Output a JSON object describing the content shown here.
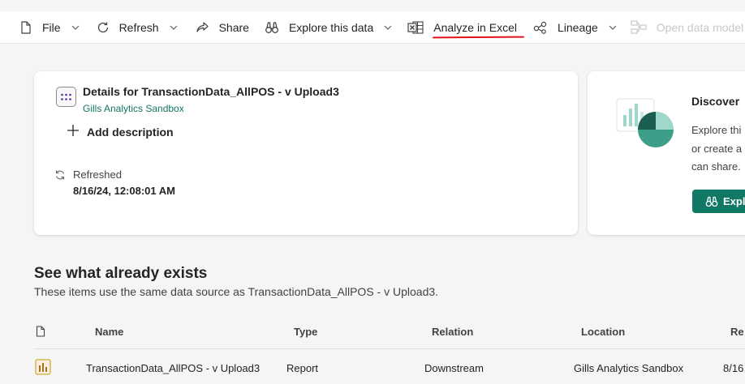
{
  "toolbar": {
    "file": "File",
    "refresh": "Refresh",
    "share": "Share",
    "explore": "Explore this data",
    "analyze": "Analyze in Excel",
    "lineage": "Lineage",
    "open_model": "Open data model"
  },
  "details": {
    "title": "Details for TransactionData_AllPOS - v Upload3",
    "workspace": "Gills Analytics Sandbox",
    "add_description": "Add description",
    "refreshed_label": "Refreshed",
    "refreshed_value": "8/16/24, 12:08:01 AM"
  },
  "discover": {
    "title": "Discover",
    "line1": "Explore thi",
    "line2": "or create a",
    "line3": "can share.",
    "button": "Expl"
  },
  "section": {
    "title": "See what already exists",
    "subtitle": "These items use the same data source as TransactionData_AllPOS - v Upload3."
  },
  "table": {
    "headers": {
      "name": "Name",
      "type": "Type",
      "relation": "Relation",
      "location": "Location",
      "refreshed": "Re"
    },
    "rows": [
      {
        "name": "TransactionData_AllPOS - v Upload3",
        "type": "Report",
        "relation": "Downstream",
        "location": "Gills Analytics Sandbox",
        "refreshed": "8/16"
      }
    ]
  },
  "colors": {
    "accent": "#117865",
    "annotation": "#e0121a",
    "excel": "#107c41"
  }
}
